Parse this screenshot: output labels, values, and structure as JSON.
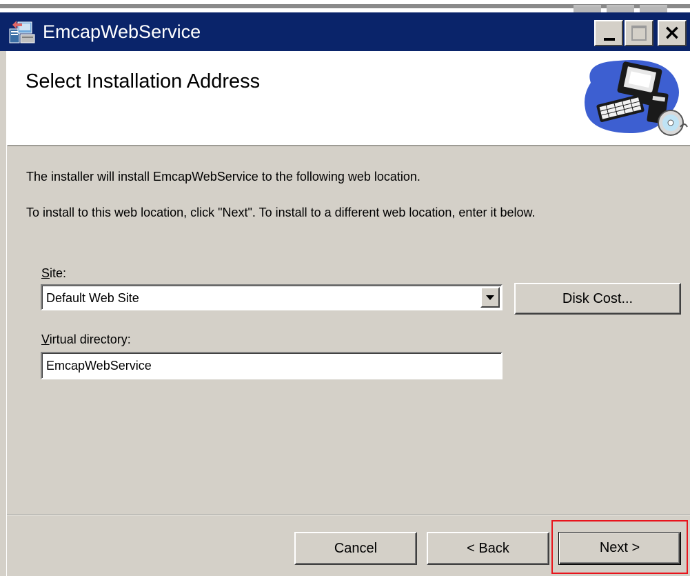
{
  "window": {
    "title": "EmcapWebService",
    "icon": "installer-app-icon",
    "controls": [
      "minimize-icon",
      "maximize-icon",
      "close-icon"
    ]
  },
  "banner": {
    "title": "Select Installation Address",
    "graphic": "computer-with-disc-icon"
  },
  "body": {
    "line1": "The installer will install EmcapWebService to the following web location.",
    "line2": "To install to this web location, click \"Next\". To install to a different web location, enter it below."
  },
  "site": {
    "label_accel": "S",
    "label_rest": "ite:",
    "selected": "Default Web Site"
  },
  "virtual_directory": {
    "label_accel": "V",
    "label_rest": "irtual directory:",
    "value": "EmcapWebService"
  },
  "buttons": {
    "disk_cost": "Disk Cost...",
    "cancel": "Cancel",
    "back": "< Back",
    "next": "Next >"
  },
  "colors": {
    "titlebar": "#0a246a",
    "face": "#d4d0c8",
    "highlight": "#e8141c"
  }
}
